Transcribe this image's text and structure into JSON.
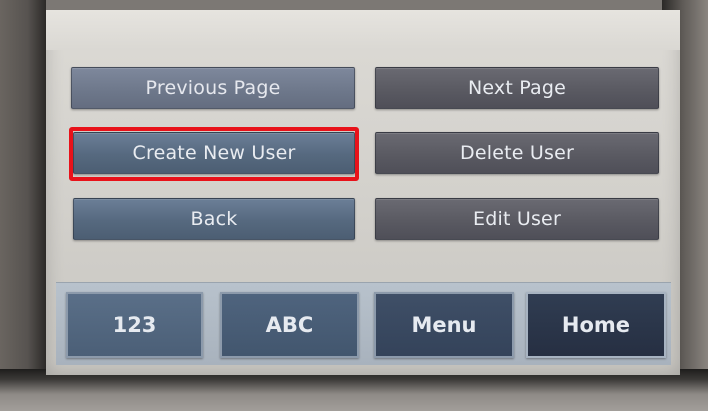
{
  "buttons": {
    "previous_page": "Previous Page",
    "next_page": "Next Page",
    "create_new_user": "Create New User",
    "delete_user": "Delete User",
    "back": "Back",
    "edit_user": "Edit User"
  },
  "bottom_tabs": {
    "numeric": "123",
    "alpha": "ABC",
    "menu": "Menu",
    "home": "Home"
  },
  "highlight": {
    "target": "create_new_user",
    "color": "#e8121a"
  }
}
